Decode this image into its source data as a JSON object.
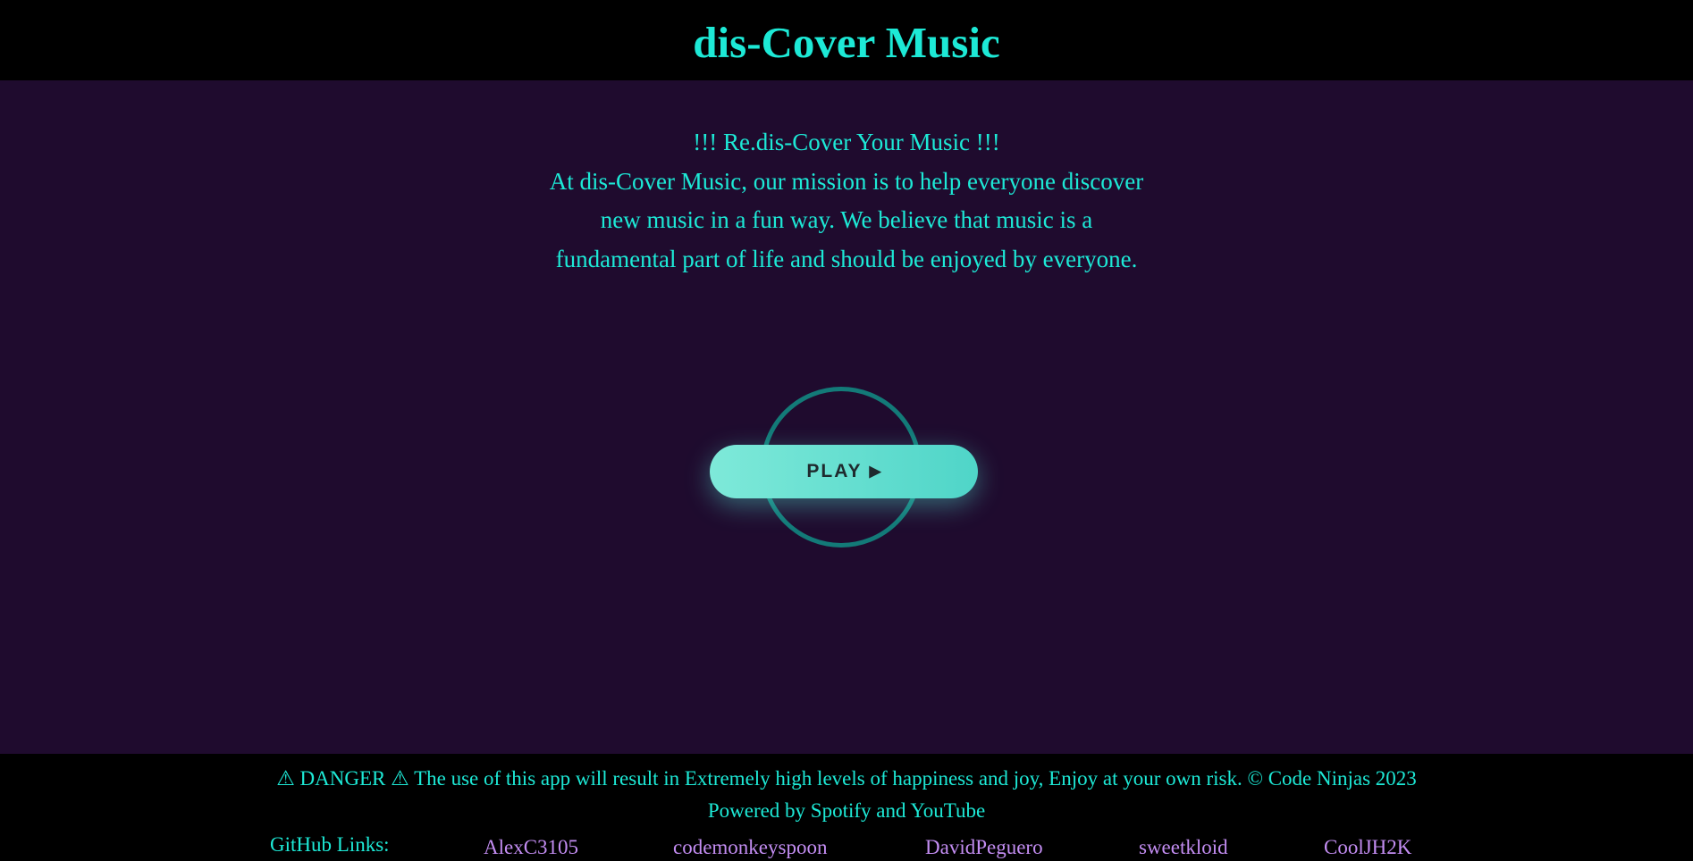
{
  "header": {
    "title": "dis-Cover Music"
  },
  "intro": {
    "tagline": "!!! Re.dis-Cover Your Music !!!",
    "mission_lines": [
      "At dis-Cover Music, our mission is to help everyone discover",
      "new music in a fun way. We believe that music is a",
      "fundamental part of life and should be enjoyed by everyone."
    ]
  },
  "play": {
    "label": "PLAY",
    "icon": "▶",
    "icon_name": "play-triangle-icon"
  },
  "footer": {
    "danger_text": "⚠ DANGER ⚠ The use of this app will result in Extremely high levels of happiness and joy, Enjoy at your own risk. © Code Ninjas 2023",
    "powered_text": "Powered by Spotify and YouTube",
    "github_label": "GitHub Links:",
    "github_links": [
      "AlexC3105",
      "codemonkeyspoon",
      "DavidPeguero",
      "sweetkloid",
      "CoolJH2K"
    ]
  },
  "colors": {
    "bar_background": "#000000",
    "page_background": "#1f0b2e",
    "accent_teal": "#1de9d6",
    "link_purple": "#c38df2",
    "button_gradient_start": "#7ee9d9",
    "button_gradient_end": "#4fd5c8",
    "ring": "#137a78"
  }
}
